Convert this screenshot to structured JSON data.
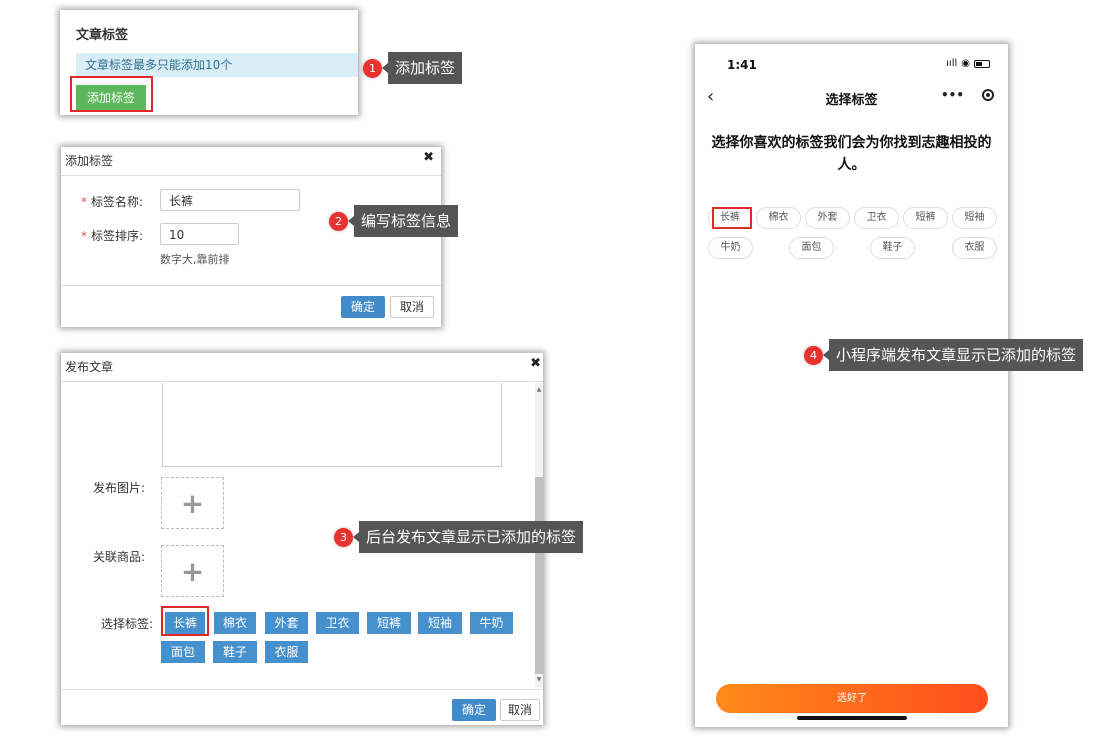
{
  "panel1": {
    "title": "文章标签",
    "info": "文章标签最多只能添加10个",
    "add_button": "添加标签"
  },
  "panel2": {
    "title": "添加标签",
    "close": "✖",
    "required_mark": "*",
    "name_label": "标签名称:",
    "name_value": "长裤",
    "order_label": "标签排序:",
    "order_value": "10",
    "order_hint": "数字大,靠前排",
    "confirm": "确定",
    "cancel": "取消"
  },
  "panel3": {
    "title": "发布文章",
    "close": "✖",
    "image_label": "发布图片:",
    "product_label": "关联商品:",
    "tags_label": "选择标签:",
    "tags": [
      "长裤",
      "棉衣",
      "外套",
      "卫衣",
      "短裤",
      "短袖",
      "牛奶",
      "面包",
      "鞋子",
      "衣服"
    ],
    "confirm": "确定",
    "cancel": "取消"
  },
  "phone": {
    "time": "1:41",
    "signal": "ııll",
    "nav_title": "选择标签",
    "back": "‹",
    "more": "•••",
    "heading": "选择你喜欢的标签我们会为你找到志趣相投的人。",
    "tags": [
      "长裤",
      "棉衣",
      "外套",
      "卫衣",
      "短裤",
      "短袖",
      "牛奶",
      "面包",
      "鞋子",
      "衣服"
    ],
    "cta": "选好了"
  },
  "callouts": [
    {
      "num": "1",
      "text": "添加标签"
    },
    {
      "num": "2",
      "text": "编写标签信息"
    },
    {
      "num": "3",
      "text": "后台发布文章显示已添加的标签"
    },
    {
      "num": "4",
      "text": "小程序端发布文章显示已添加的标签"
    }
  ],
  "colors": {
    "accent_red": "#e02a2a",
    "tag_blue": "#4690cd",
    "success_green": "#5cb85c",
    "primary_blue": "#428bca",
    "cta_orange": "#ff6a1a"
  }
}
